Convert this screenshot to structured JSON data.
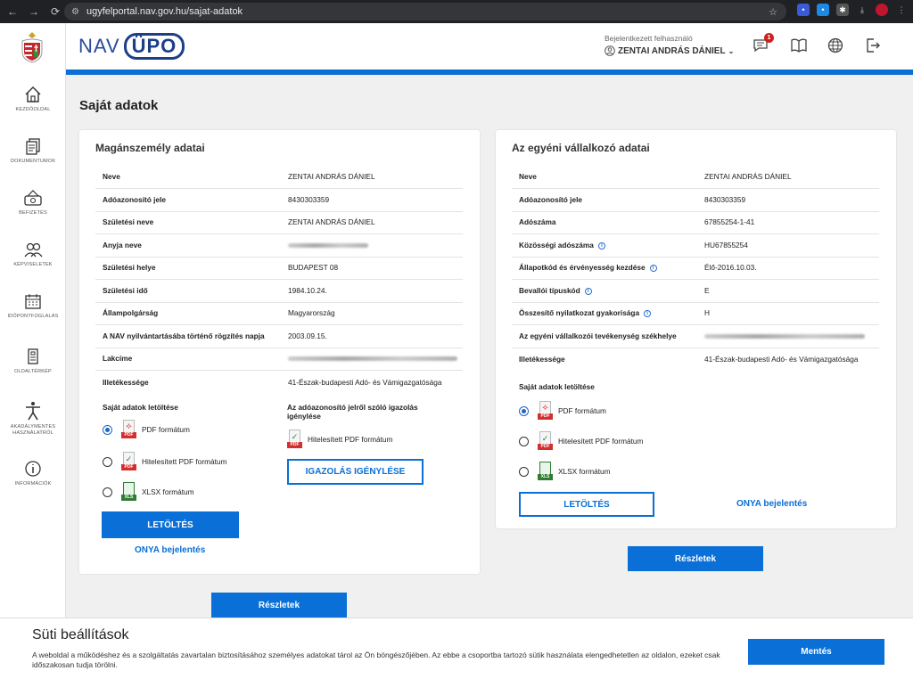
{
  "browser": {
    "url": "ugyfelportal.nav.gov.hu/sajat-adatok"
  },
  "sidebar": {
    "items": [
      {
        "label": "KEZDŐOLDAL"
      },
      {
        "label": "DOKUMENTUMOK"
      },
      {
        "label": "BEFIZETÉS"
      },
      {
        "label": "KÉPVISELETEK"
      },
      {
        "label": "IDŐPONTFOGLALÁS"
      },
      {
        "label": "OLDALTÉRKÉP"
      },
      {
        "label": "AKADÁLYMENTES HASZNÁLATRÓL"
      },
      {
        "label": "INFORMÁCIÓK"
      }
    ]
  },
  "header": {
    "logo_nav": "NAV",
    "logo_upo": "ÜPO",
    "user_label": "Bejelentkezett felhasználó",
    "user_name": "ZENTAI ANDRÁS DÁNIEL",
    "notification_count": "1"
  },
  "page_title": "Saját adatok",
  "left_card": {
    "title": "Magánszemély adatai",
    "rows": [
      {
        "k": "Neve",
        "v": "ZENTAI ANDRÁS DÁNIEL"
      },
      {
        "k": "Adóazonosító jele",
        "v": "8430303359"
      },
      {
        "k": "Születési neve",
        "v": "ZENTAI ANDRÁS DÁNIEL"
      },
      {
        "k": "Anyja neve",
        "v": ""
      },
      {
        "k": "Születési helye",
        "v": "BUDAPEST 08"
      },
      {
        "k": "Születési idő",
        "v": "1984.10.24."
      },
      {
        "k": "Állampolgárság",
        "v": "Magyarország"
      },
      {
        "k": "A NAV nyilvántartásába történő rögzítés napja",
        "v": "2003.09.15."
      },
      {
        "k": "Lakcíme",
        "v": ""
      },
      {
        "k": "Illetékessége",
        "v": "41-Észak-budapesti Adó- és Vámigazgatósága"
      }
    ],
    "download_title": "Saját adatok letöltése",
    "formats": [
      "PDF formátum",
      "Hitelesített PDF formátum",
      "XLSX formátum"
    ],
    "tag_pdf": "PDF",
    "tag_xls": "XLS",
    "certificate_title": "Az adóazonosító jelről szóló igazolás igénylése",
    "certificate_format": "Hitelesített PDF formátum",
    "certificate_button": "IGAZOLÁS IGÉNYLÉSE",
    "download_button": "LETÖLTÉS",
    "onya_link": "ONYA bejelentés",
    "details_button": "Részletek"
  },
  "right_card": {
    "title": "Az egyéni vállalkozó adatai",
    "rows": [
      {
        "k": "Neve",
        "v": "ZENTAI ANDRÁS DÁNIEL"
      },
      {
        "k": "Adóazonosító jele",
        "v": "8430303359"
      },
      {
        "k": "Adószáma",
        "v": "67855254-1-41"
      },
      {
        "k": "Közösségi adószáma",
        "v": "HU67855254"
      },
      {
        "k": "Állapotkód és érvényesség kezdése",
        "v": "Élő-2016.10.03."
      },
      {
        "k": "Bevallói típuskód",
        "v": "E"
      },
      {
        "k": "Összesítő nyilatkozat gyakorisága",
        "v": "H"
      },
      {
        "k": "Az egyéni vállalkozói tevékenység székhelye",
        "v": ""
      },
      {
        "k": "Illetékessége",
        "v": "41-Észak-budapesti Adó- és Vámigazgatósága"
      }
    ],
    "download_title": "Saját adatok letöltése",
    "formats": [
      "PDF formátum",
      "Hitelesített PDF formátum",
      "XLSX formátum"
    ],
    "download_button": "LETÖLTÉS",
    "onya_link": "ONYA bejelentés",
    "details_button": "Részletek"
  },
  "cookie": {
    "title": "Süti beállítások",
    "text": "A weboldal a működéshez és a szolgáltatás zavartalan biztosításához személyes adatokat tárol az Ön böngészőjében. Az ebbe a csoportba tartozó sütik használata elengedhetetlen az oldalon, ezeket csak időszakosan tudja törölni.",
    "save_button": "Mentés"
  },
  "colors": {
    "accent": "#0a6fd6",
    "stripe": "#0a6fd6",
    "pdf_red": "#d32f2f",
    "xls_green": "#2e7d32"
  }
}
